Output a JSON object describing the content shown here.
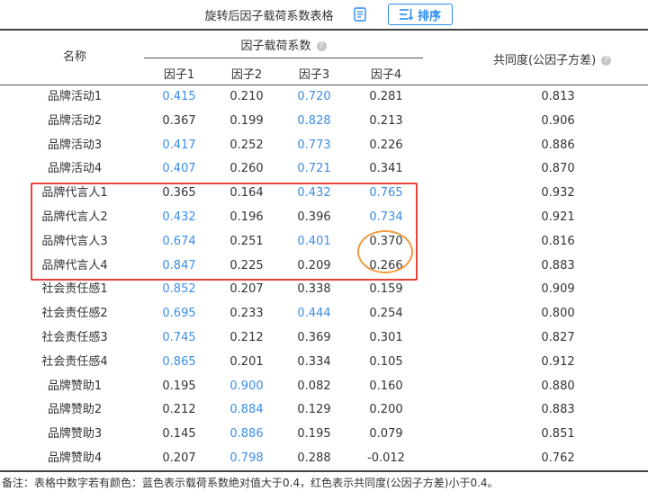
{
  "header": {
    "title": "旋转后因子载荷系数表格",
    "sort_label": "排序"
  },
  "table": {
    "col_name": "名称",
    "col_group": "因子载荷系数",
    "col_f1": "因子1",
    "col_f2": "因子2",
    "col_f3": "因子3",
    "col_f4": "因子4",
    "col_communality": "共同度(公因子方差)",
    "help_glyph": "?",
    "rows": [
      {
        "name": "品牌活动1",
        "f1": "0.415",
        "f2": "0.210",
        "f3": "0.720",
        "f4": "0.281",
        "com": "0.813"
      },
      {
        "name": "品牌活动2",
        "f1": "0.367",
        "f2": "0.199",
        "f3": "0.828",
        "f4": "0.213",
        "com": "0.906"
      },
      {
        "name": "品牌活动3",
        "f1": "0.417",
        "f2": "0.252",
        "f3": "0.773",
        "f4": "0.226",
        "com": "0.886"
      },
      {
        "name": "品牌活动4",
        "f1": "0.407",
        "f2": "0.260",
        "f3": "0.721",
        "f4": "0.341",
        "com": "0.870"
      },
      {
        "name": "品牌代言人1",
        "f1": "0.365",
        "f2": "0.164",
        "f3": "0.432",
        "f4": "0.765",
        "com": "0.932"
      },
      {
        "name": "品牌代言人2",
        "f1": "0.432",
        "f2": "0.196",
        "f3": "0.396",
        "f4": "0.734",
        "com": "0.921"
      },
      {
        "name": "品牌代言人3",
        "f1": "0.674",
        "f2": "0.251",
        "f3": "0.401",
        "f4": "0.370",
        "com": "0.816"
      },
      {
        "name": "品牌代言人4",
        "f1": "0.847",
        "f2": "0.225",
        "f3": "0.209",
        "f4": "0.266",
        "com": "0.883"
      },
      {
        "name": "社会责任感1",
        "f1": "0.852",
        "f2": "0.207",
        "f3": "0.338",
        "f4": "0.159",
        "com": "0.909"
      },
      {
        "name": "社会责任感2",
        "f1": "0.695",
        "f2": "0.233",
        "f3": "0.444",
        "f4": "0.254",
        "com": "0.800"
      },
      {
        "name": "社会责任感3",
        "f1": "0.745",
        "f2": "0.212",
        "f3": "0.369",
        "f4": "0.301",
        "com": "0.827"
      },
      {
        "name": "社会责任感4",
        "f1": "0.865",
        "f2": "0.201",
        "f3": "0.334",
        "f4": "0.105",
        "com": "0.912"
      },
      {
        "name": "品牌赞助1",
        "f1": "0.195",
        "f2": "0.900",
        "f3": "0.082",
        "f4": "0.160",
        "com": "0.880"
      },
      {
        "name": "品牌赞助2",
        "f1": "0.212",
        "f2": "0.884",
        "f3": "0.129",
        "f4": "0.200",
        "com": "0.883"
      },
      {
        "name": "品牌赞助3",
        "f1": "0.145",
        "f2": "0.886",
        "f3": "0.195",
        "f4": "0.079",
        "com": "0.851"
      },
      {
        "name": "品牌赞助4",
        "f1": "0.207",
        "f2": "0.798",
        "f3": "0.288",
        "f4": "-0.012",
        "com": "0.762"
      }
    ]
  },
  "footnote": "备注：表格中数字若有颜色：蓝色表示载荷系数绝对值大于0.4，红色表示共同度(公因子方差)小于0.4。",
  "colors": {
    "highlight_blue": "#3a8ee6",
    "accent": "#2c8cf0",
    "annotation_box": "#e8403a",
    "annotation_circle": "#f09a3e"
  }
}
